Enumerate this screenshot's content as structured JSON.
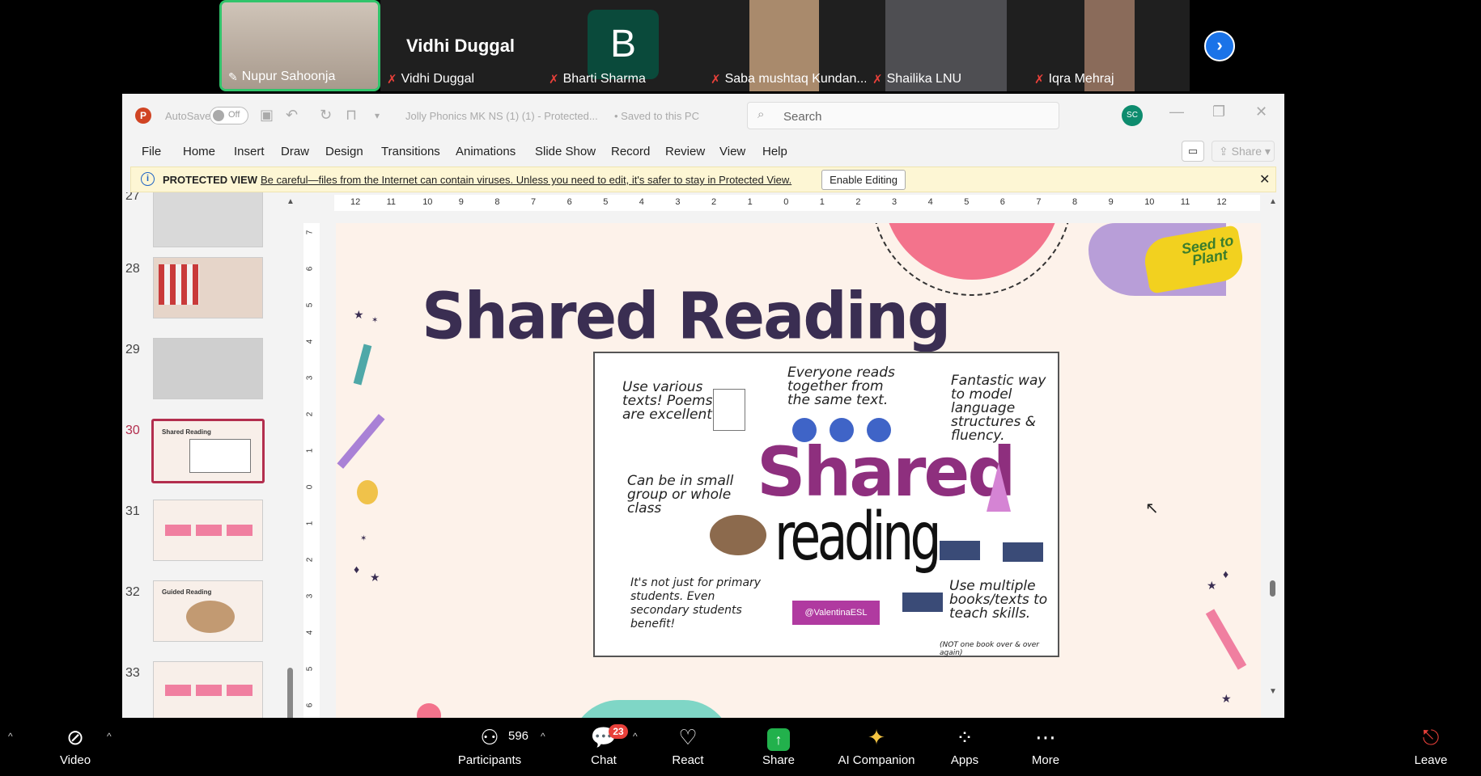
{
  "participants": [
    {
      "name": "Nupur Sahoonja",
      "muted": false
    },
    {
      "name": "Vidhi Duggal",
      "muted": true,
      "display": "Vidhi Duggal"
    },
    {
      "name": "Bharti Sharma",
      "muted": true,
      "initial": "B"
    },
    {
      "name": "Saba mushtaq Kundan...",
      "muted": true
    },
    {
      "name": "Shailika LNU",
      "muted": true
    },
    {
      "name": "Iqra Mehraj",
      "muted": true
    }
  ],
  "ppt": {
    "autosave": "AutoSave",
    "toggle": "Off",
    "doc_title": "Jolly Phonics MK NS (1) (1)  -  Protected...",
    "saved": "•  Saved to this PC",
    "search_placeholder": "Search",
    "avatar": "SC",
    "share": "Share",
    "menu": [
      "File",
      "Home",
      "Insert",
      "Draw",
      "Design",
      "Transitions",
      "Animations",
      "Slide Show",
      "Record",
      "Review",
      "View",
      "Help"
    ],
    "protected": {
      "label": "PROTECTED VIEW",
      "message": "Be careful—files from the Internet can contain viruses. Unless you need to edit, it's safer to stay in Protected View.",
      "button": "Enable Editing"
    },
    "thumbnails": [
      {
        "num": "27",
        "title": ""
      },
      {
        "num": "28",
        "title": ""
      },
      {
        "num": "29",
        "title": ""
      },
      {
        "num": "30",
        "title": "Shared Reading",
        "selected": true
      },
      {
        "num": "31",
        "title": ""
      },
      {
        "num": "32",
        "title": "Guided Reading"
      },
      {
        "num": "33",
        "title": ""
      }
    ],
    "ruler_h": [
      "12",
      "11",
      "10",
      "9",
      "8",
      "7",
      "6",
      "5",
      "4",
      "3",
      "2",
      "1",
      "0",
      "1",
      "2",
      "3",
      "4",
      "5",
      "6",
      "7",
      "8",
      "9",
      "10",
      "11",
      "12"
    ],
    "ruler_v": [
      "7",
      "6",
      "5",
      "4",
      "3",
      "2",
      "1",
      "0",
      "1",
      "2",
      "3",
      "4",
      "5",
      "6"
    ],
    "slide": {
      "title": "Shared Reading",
      "logo": "Seed to Plant",
      "notes": [
        "Use various texts! Poems are excellent!",
        "Everyone reads together from the same text.",
        "Fantastic way to model language structures & fluency.",
        "Can be in small group or whole class",
        "It's not just for primary students. Even secondary students benefit!",
        "Use multiple books/texts to teach skills."
      ],
      "big1": "Shared",
      "big2": "reading",
      "tag": "@ValentinaESL",
      "footnote": "(NOT one book over & over again)"
    }
  },
  "toolbar": {
    "video": "Video",
    "participants": "Participants",
    "count": "596",
    "chat": "Chat",
    "chat_badge": "23",
    "react": "React",
    "share": "Share",
    "ai": "AI Companion",
    "apps": "Apps",
    "more": "More",
    "leave": "Leave"
  }
}
